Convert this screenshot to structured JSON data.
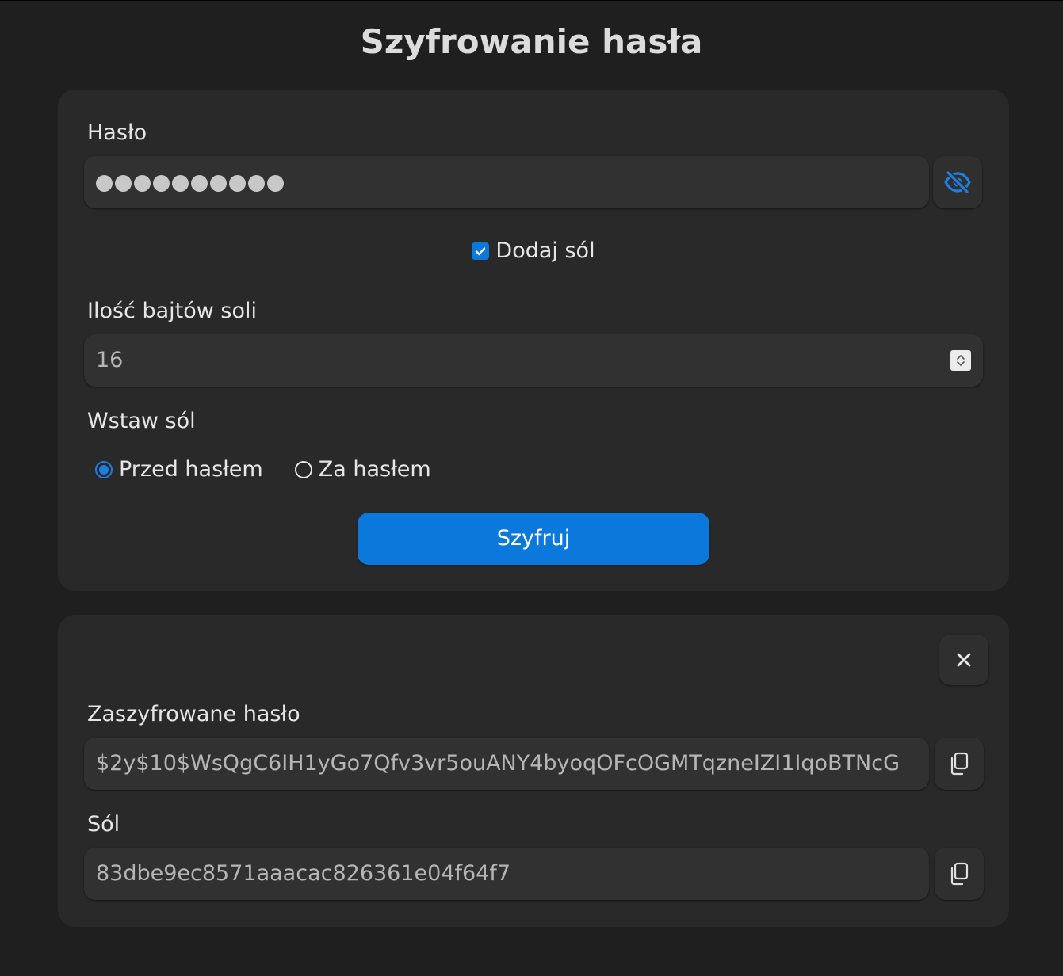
{
  "title": "Szyfrowanie hasła",
  "form": {
    "password_label": "Hasło",
    "password_masked_count": 10,
    "toggle_visibility_icon": "eye-slash-icon",
    "add_salt_label": "Dodaj sól",
    "add_salt_checked": true,
    "salt_bytes_label": "Ilość bajtów soli",
    "salt_bytes_value": "16",
    "insert_salt_label": "Wstaw sól",
    "insert_salt_options": [
      "Przed hasłem",
      "Za hasłem"
    ],
    "insert_salt_selected": "Przed hasłem",
    "encrypt_label": "Szyfruj"
  },
  "result": {
    "close_icon": "close-icon",
    "hash_label": "Zaszyfrowane hasło",
    "hash_value": "$2y$10$WsQgC6IH1yGo7Qfv3vr5ouANY4byoqOFcOGMTqzneIZI1IqoBTNcG",
    "salt_label": "Sól",
    "salt_value": "83dbe9ec8571aaacac826361e04f64f7",
    "copy_icon": "copy-icon"
  },
  "colors": {
    "accent": "#0b78dc",
    "background": "#1f1f1f",
    "card": "#292929",
    "field": "#313131"
  }
}
